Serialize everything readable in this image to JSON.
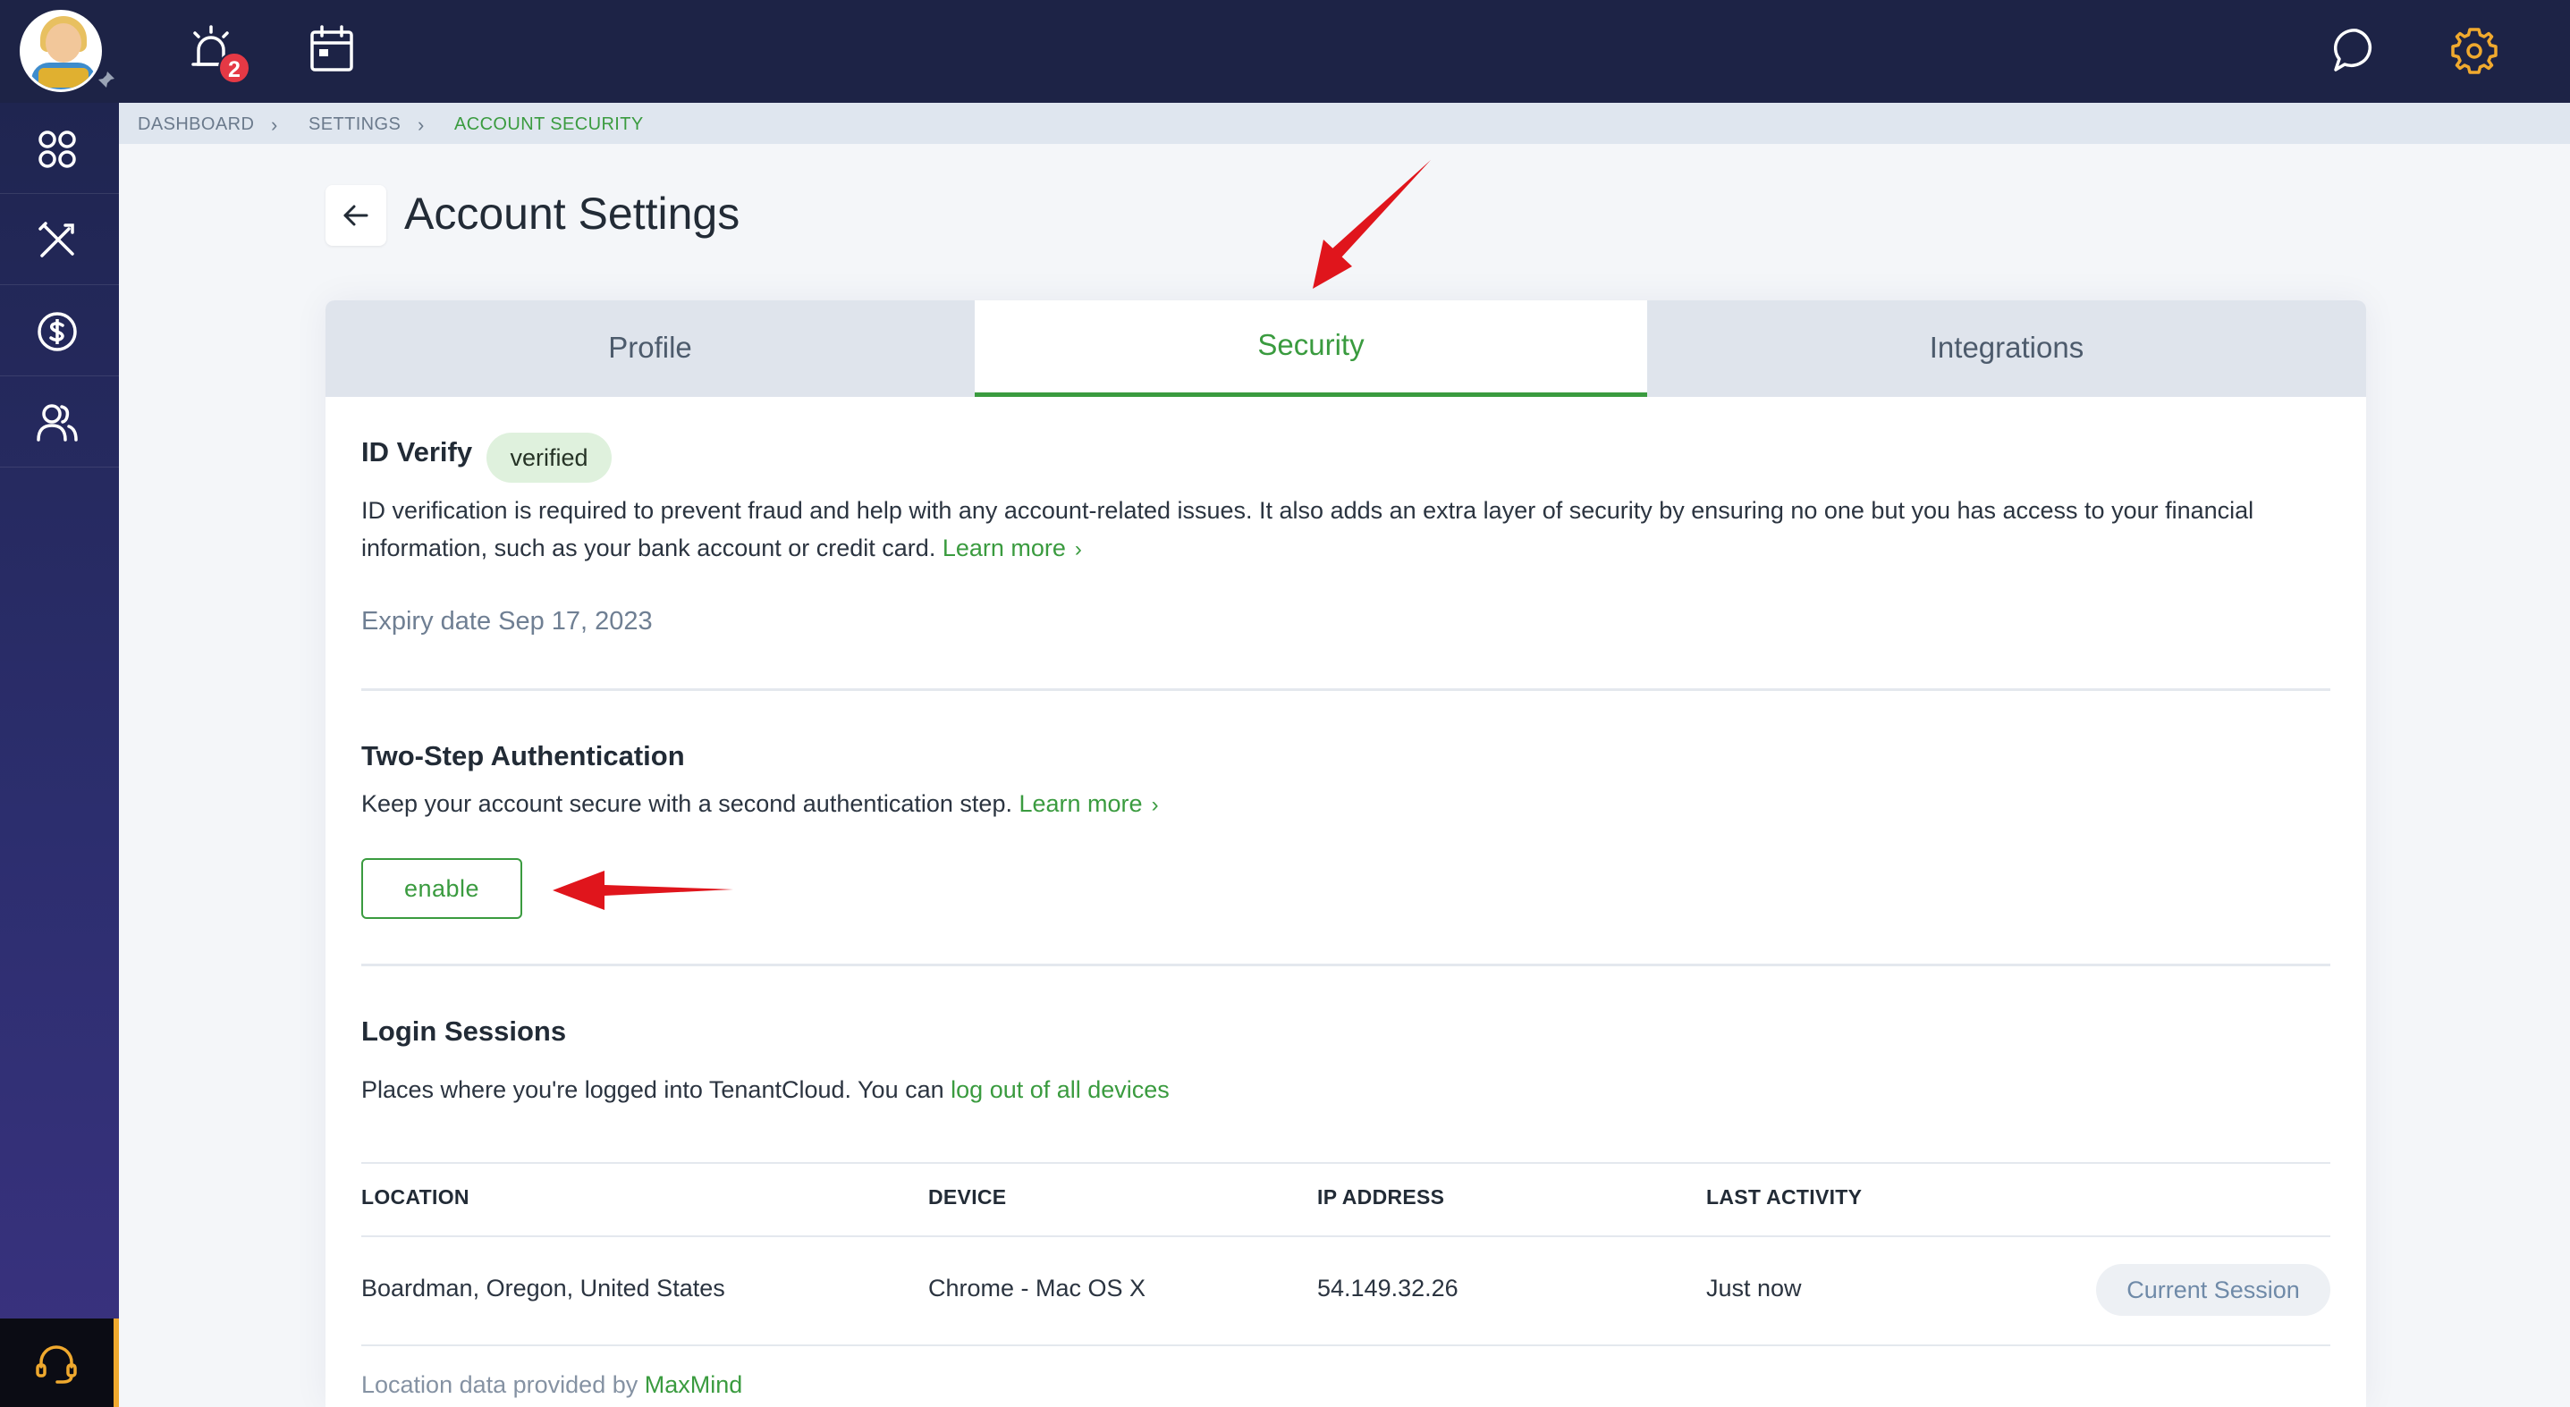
{
  "topbar": {
    "notification_count": "2",
    "icons": [
      "avatar",
      "pin-icon",
      "alarm-icon",
      "calendar-icon",
      "chat-icon",
      "gear-icon"
    ]
  },
  "sidebar": {
    "items": [
      {
        "icon": "dashboard-grid-icon"
      },
      {
        "icon": "tools-icon"
      },
      {
        "icon": "dollar-icon"
      },
      {
        "icon": "users-icon"
      }
    ],
    "support_icon": "headset-icon"
  },
  "breadcrumb": {
    "items": [
      "DASHBOARD",
      "SETTINGS",
      "ACCOUNT SECURITY"
    ]
  },
  "header": {
    "title": "Account Settings"
  },
  "tabs": [
    {
      "label": "Profile",
      "active": false
    },
    {
      "label": "Security",
      "active": true
    },
    {
      "label": "Integrations",
      "active": false
    }
  ],
  "id_verify": {
    "title": "ID Verify",
    "status": "verified",
    "description_line1": "ID verification is required to prevent fraud and help with any account-related issues. It also adds an extra layer of security by ensuring no one but you has access to your financial",
    "description_line2": "information, such as your bank account or credit card.",
    "learn_more": "Learn more",
    "expiry": "Expiry date Sep 17, 2023"
  },
  "two_step": {
    "title": "Two-Step Authentication",
    "description": "Keep your account secure with a second authentication step.",
    "learn_more": "Learn more",
    "button": "enable"
  },
  "login_sessions": {
    "title": "Login Sessions",
    "description": "Places where you're logged into TenantCloud. You can",
    "logout_link": "log out of all devices",
    "columns": [
      "LOCATION",
      "DEVICE",
      "IP ADDRESS",
      "LAST ACTIVITY"
    ],
    "rows": [
      {
        "location": "Boardman, Oregon, United States",
        "device": "Chrome - Mac OS X",
        "ip": "54.149.32.26",
        "last_activity": "Just now",
        "status": "Current Session"
      }
    ],
    "footnote_prefix": "Location data provided by",
    "footnote_link": "MaxMind"
  },
  "colors": {
    "topbar": "#1d2346",
    "accent_green": "#3a9b3f",
    "badge_red": "#e53945",
    "gear_orange": "#f0a92e",
    "annotation_red": "#e0151c"
  }
}
